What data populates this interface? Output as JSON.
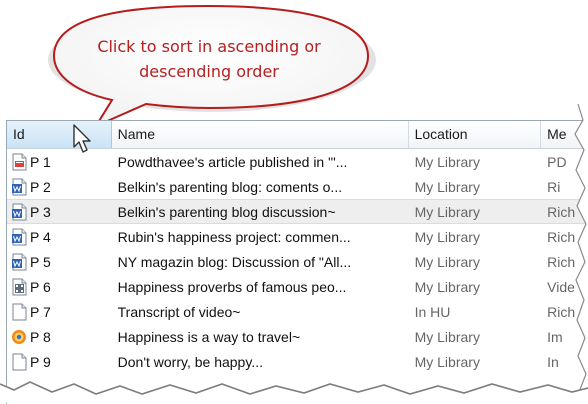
{
  "callout": {
    "line1": "Click to sort in ascending or",
    "line2": "descending order"
  },
  "columns": {
    "id": "Id",
    "name": "Name",
    "location": "Location",
    "media": "Me"
  },
  "rows": [
    {
      "id": "P 1",
      "name": "Powdthavee's article published in \"'...",
      "location": "My Library",
      "media": "PD",
      "icon": "pdf-file-icon"
    },
    {
      "id": "P 2",
      "name": "Belkin's parenting blog: coments o...",
      "location": "My Library",
      "media": "Ri",
      "icon": "word-document-icon"
    },
    {
      "id": "P 3",
      "name": "Belkin's parenting blog discussion~",
      "location": "My Library",
      "media": "Rich",
      "icon": "word-document-icon"
    },
    {
      "id": "P 4",
      "name": "Rubin's happiness project: commen...",
      "location": "My Library",
      "media": "Rich",
      "icon": "word-document-icon"
    },
    {
      "id": "P 5",
      "name": "NY magazin blog: Discussion of \"All...",
      "location": "My Library",
      "media": "Rich",
      "icon": "word-document-icon"
    },
    {
      "id": "P 6",
      "name": "Happiness proverbs of famous peo...",
      "location": "My Library",
      "media": "Vide",
      "icon": "video-file-icon"
    },
    {
      "id": "P 7",
      "name": "Transcript of video~",
      "location": "In HU",
      "media": "Rich",
      "icon": "text-file-icon"
    },
    {
      "id": "P 8",
      "name": "Happiness is a way to travel~",
      "location": "My Library",
      "media": "Im",
      "icon": "image-file-icon"
    },
    {
      "id": "P 9",
      "name": "Don't worry, be happy...",
      "location": "My Library",
      "media": "In",
      "icon": "text-file-icon"
    }
  ],
  "colors": {
    "callout_border": "#b51c1c",
    "callout_text": "#b52020",
    "selected_header": "#c9e3f6"
  }
}
